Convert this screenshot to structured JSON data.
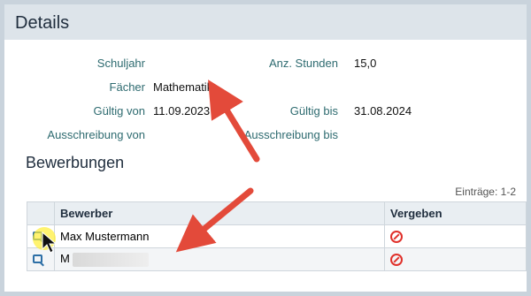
{
  "panel": {
    "title": "Details"
  },
  "details": {
    "schuljahr_label": "Schuljahr",
    "schuljahr_value": "",
    "faecher_label": "Fächer",
    "faecher_value": "Mathematik",
    "gueltig_von_label": "Gültig von",
    "gueltig_von_value": "11.09.2023",
    "ausschreibung_von_label": "Ausschreibung von",
    "anz_stunden_label": "Anz. Stunden",
    "anz_stunden_value": "15,0",
    "gueltig_bis_label": "Gültig bis",
    "gueltig_bis_value": "31.08.2024",
    "ausschreibung_bis_label": "Ausschreibung bis"
  },
  "bewerbungen": {
    "title": "Bewerbungen",
    "count": "Einträge: 1-2",
    "columns": [
      "Bewerber",
      "Vergeben"
    ],
    "rows": [
      {
        "name": "Max Mustermann",
        "icon": "view-icon",
        "status_icon": "blocked-icon"
      },
      {
        "name": "M",
        "icon": "view-icon",
        "status_icon": "blocked-icon"
      }
    ]
  },
  "colors": {
    "label": "#2e6b70",
    "header_bg": "#dde4ea",
    "arrow": "#e34a3a",
    "blocked": "#e0312b",
    "link_icon": "#2d6fa6"
  }
}
